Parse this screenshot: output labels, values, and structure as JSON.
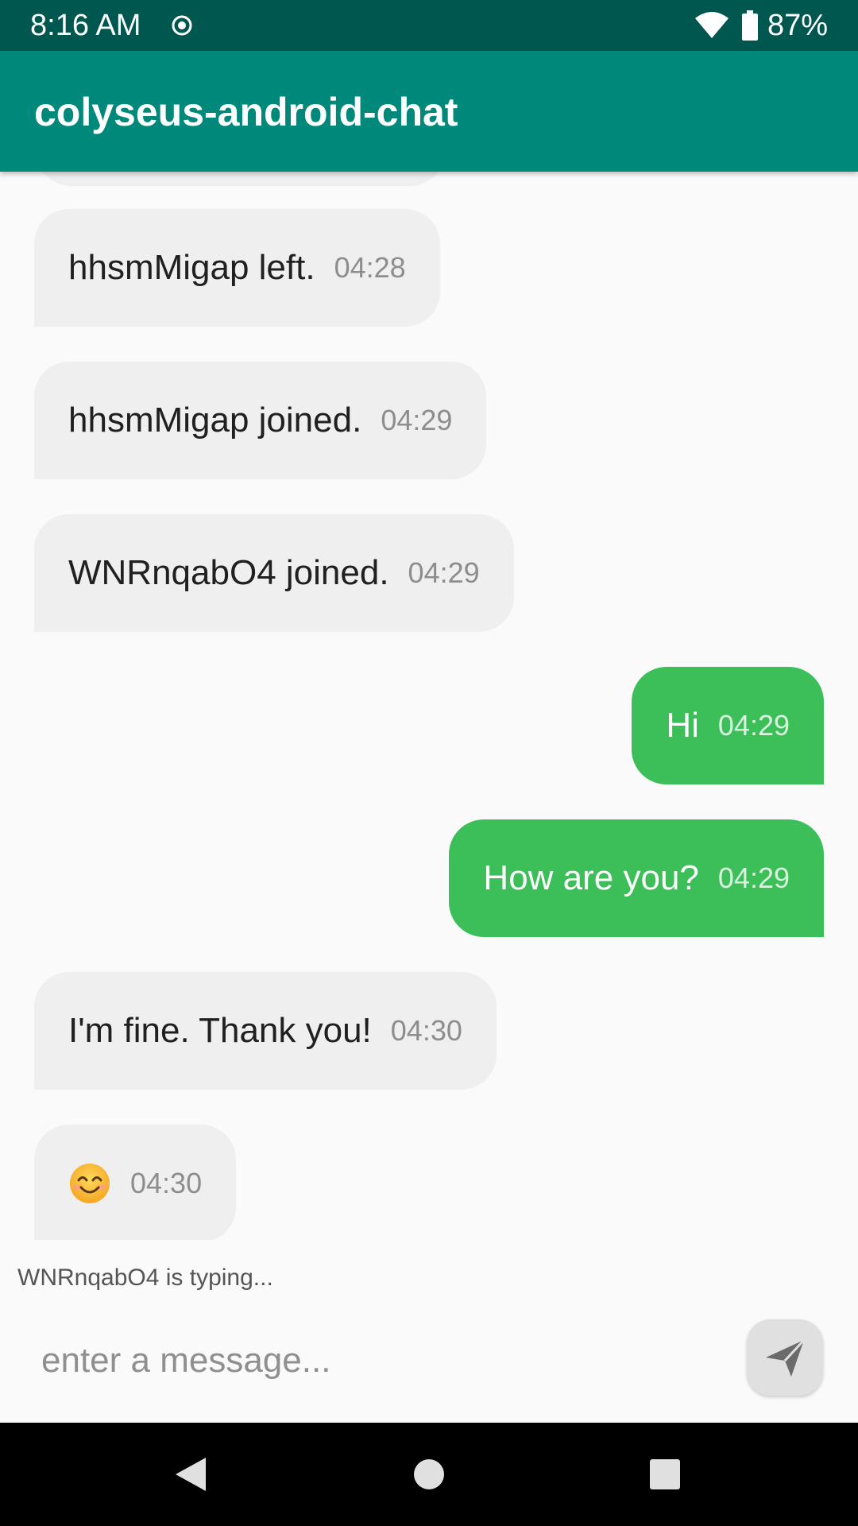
{
  "status_bar": {
    "time": "8:16 AM",
    "battery": "87%",
    "icons": [
      "target-icon",
      "wifi-icon",
      "battery-icon"
    ]
  },
  "app_bar": {
    "title": "colyseus-android-chat"
  },
  "messages": [
    {
      "direction": "in",
      "text": "hhsmMigap left.",
      "time": "04:28"
    },
    {
      "direction": "in",
      "text": "hhsmMigap joined.",
      "time": "04:29"
    },
    {
      "direction": "in",
      "text": "WNRnqabO4 joined.",
      "time": "04:29"
    },
    {
      "direction": "out",
      "text": "Hi",
      "time": "04:29"
    },
    {
      "direction": "out",
      "text": "How are you?",
      "time": "04:29"
    },
    {
      "direction": "in",
      "text": "I'm fine. Thank you!",
      "time": "04:30"
    },
    {
      "direction": "in",
      "text": "😊",
      "icon": "smiling-face-emoji",
      "time": "04:30"
    }
  ],
  "typing_indicator": "WNRnqabO4 is typing...",
  "composer": {
    "placeholder": "enter a message...",
    "value": "",
    "send_icon": "send-icon"
  },
  "nav_bar": {
    "icons": [
      "back-icon",
      "home-icon",
      "recents-icon"
    ]
  },
  "colors": {
    "status_bar": "#00574f",
    "app_bar": "#00897b",
    "incoming_bubble": "#efefef",
    "outgoing_bubble": "#3cbe58",
    "background": "#fafafa"
  }
}
